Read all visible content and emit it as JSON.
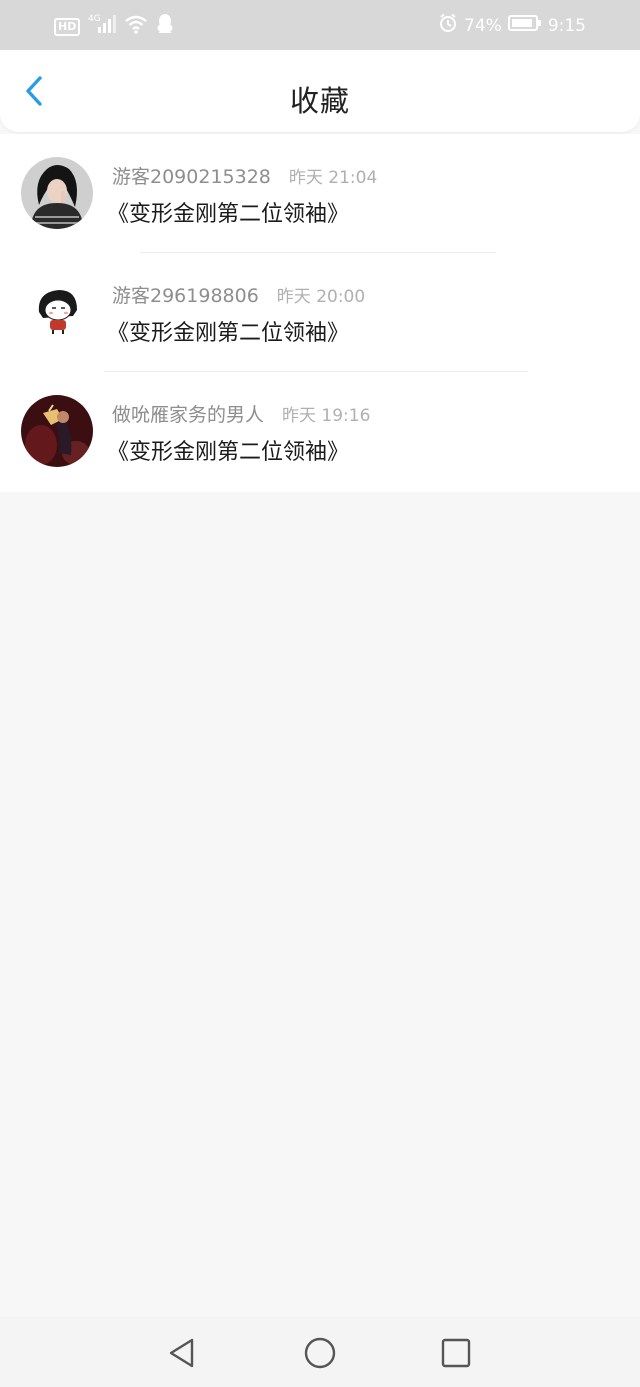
{
  "status_bar": {
    "hd": "HD",
    "network": "4G",
    "battery_percent": "74%",
    "time": "9:15",
    "icons": [
      "signal-icon",
      "wifi-icon",
      "qq-icon",
      "alarm-icon",
      "battery-icon"
    ]
  },
  "header": {
    "title": "收藏",
    "back_icon": "chevron-left-icon",
    "accent_color": "#2b9be8"
  },
  "favorites": [
    {
      "username": "游客2090215328",
      "time": "昨天 21:04",
      "title": "《变形金刚第二位领袖》"
    },
    {
      "username": "游客296198806",
      "time": "昨天 20:00",
      "title": "《变形金刚第二位领袖》"
    },
    {
      "username": "做吮雁家务的男人",
      "time": "昨天 19:16",
      "title": "《变形金刚第二位领袖》"
    }
  ],
  "nav": {
    "icons": [
      "back-triangle-icon",
      "home-circle-icon",
      "recents-square-icon"
    ]
  }
}
